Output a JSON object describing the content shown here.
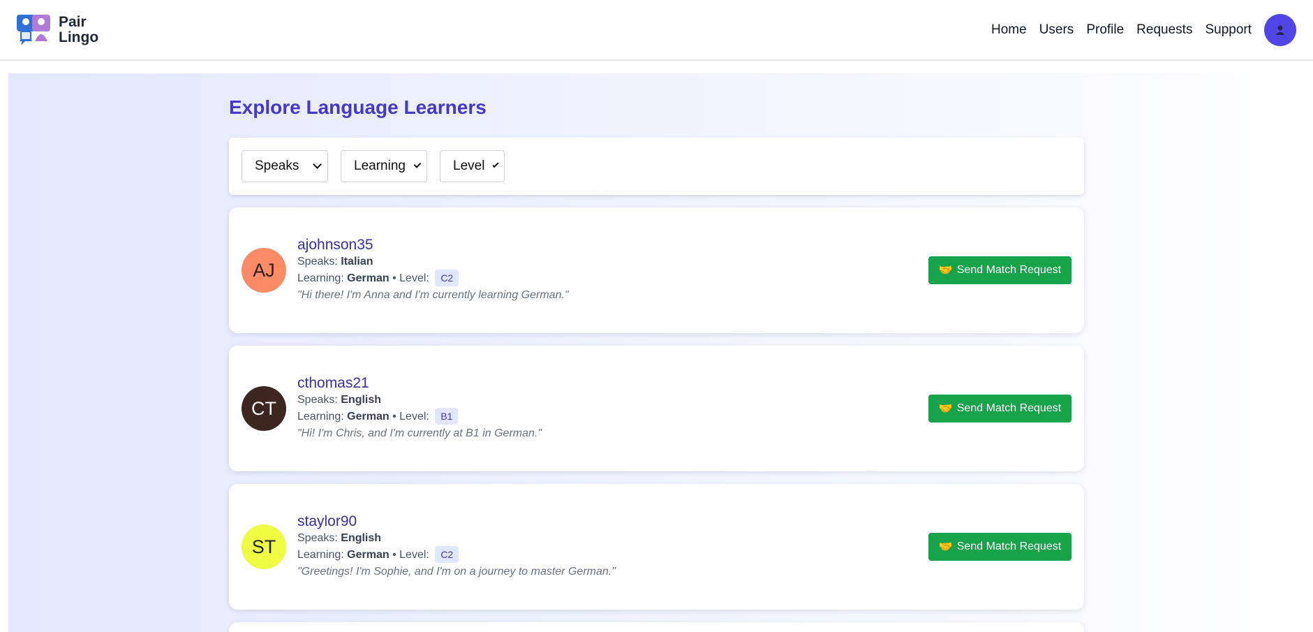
{
  "brand": {
    "line1": "Pair",
    "line2": "Lingo"
  },
  "nav": {
    "items": [
      "Home",
      "Users",
      "Profile",
      "Requests",
      "Support"
    ]
  },
  "page": {
    "title": "Explore Language Learners"
  },
  "filters": {
    "speaks": "Speaks",
    "learning": "Learning",
    "level": "Level"
  },
  "labels": {
    "speaks": "Speaks:",
    "learning": "Learning:",
    "bullet": "•",
    "level": "Level:",
    "button": "Send Match Request"
  },
  "users": [
    {
      "initials": "AJ",
      "username": "ajohnson35",
      "speaks": "Italian",
      "learning": "German",
      "level": "C2",
      "bio": "\"Hi there! I'm Anna and I'm currently learning German.\"",
      "color": "#fc8a65",
      "text_color": "#222"
    },
    {
      "initials": "CT",
      "username": "cthomas21",
      "speaks": "English",
      "learning": "German",
      "level": "B1",
      "bio": "\"Hi! I'm Chris, and I'm currently at B1 in German.\"",
      "color": "#3d2620",
      "text_color": "#ffffff"
    },
    {
      "initials": "ST",
      "username": "staylor90",
      "speaks": "English",
      "learning": "German",
      "level": "C2",
      "bio": "\"Greetings! I'm Sophie, and I'm on a journey to master German.\"",
      "color": "#eefc44",
      "text_color": "#222"
    }
  ],
  "colors": {
    "accent": "#4338ca",
    "button": "#16a34a",
    "avatar_btn": "#4f46e5"
  },
  "icons": {
    "logo": "pair-lingo-logo",
    "user": "user-icon",
    "handshake": "handshake-icon",
    "dropdown": "chevron-down-icon"
  }
}
